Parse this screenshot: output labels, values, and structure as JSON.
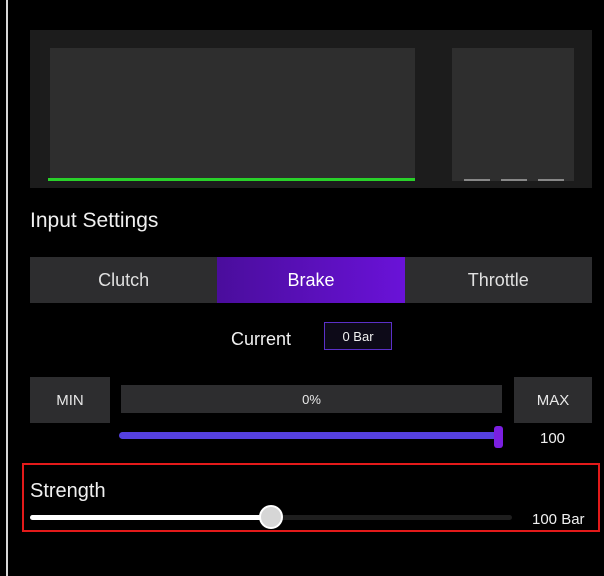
{
  "graph": {
    "trace_color": "#29d12a"
  },
  "input_settings": {
    "title": "Input Settings",
    "tabs": [
      {
        "label": "Clutch",
        "active": false
      },
      {
        "label": "Brake",
        "active": true
      },
      {
        "label": "Throttle",
        "active": false
      }
    ],
    "current": {
      "label": "Current",
      "value": "0 Bar"
    }
  },
  "range": {
    "min_label": "MIN",
    "max_label": "MAX",
    "percent_text": "0%",
    "slider_fraction": 1.0,
    "max_value": "100",
    "accent_color": "#5540e0"
  },
  "strength": {
    "label": "Strength",
    "value_text": "100 Bar",
    "slider_fraction": 0.5,
    "highlight_color": "#e31a1a"
  }
}
